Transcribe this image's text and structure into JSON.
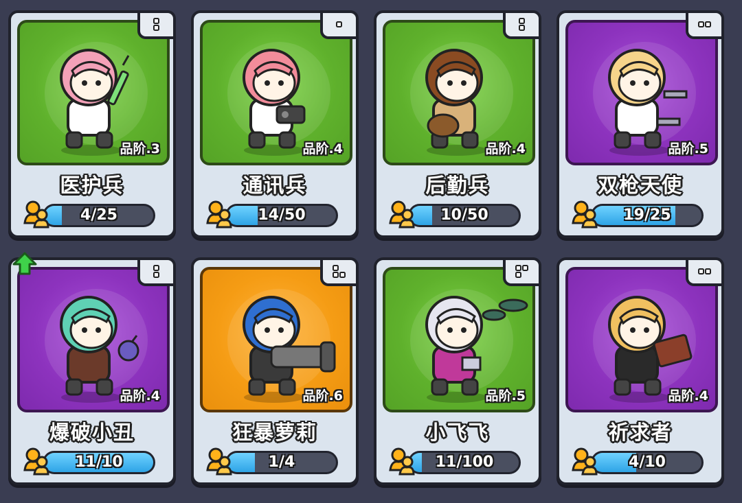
{
  "cards": [
    {
      "name": "医护兵",
      "grade": "品阶.3",
      "progress": "4/25",
      "fill": 0.16,
      "bg": "green",
      "pips": "2v",
      "upgrade": false,
      "hair": "#f3a1b8",
      "outfit": "#ffffff",
      "item": "syringe"
    },
    {
      "name": "通讯兵",
      "grade": "品阶.4",
      "progress": "14/50",
      "fill": 0.28,
      "bg": "green",
      "pips": "1",
      "upgrade": false,
      "hair": "#f28c9a",
      "outfit": "#ffffff",
      "item": "radio"
    },
    {
      "name": "后勤兵",
      "grade": "品阶.4",
      "progress": "10/50",
      "fill": 0.2,
      "bg": "green",
      "pips": "2v",
      "upgrade": false,
      "hair": "#8a4b22",
      "outfit": "#d9b27a",
      "item": "bag"
    },
    {
      "name": "双枪天使",
      "grade": "品阶.5",
      "progress": "19/25",
      "fill": 0.76,
      "bg": "purple",
      "pips": "2h",
      "upgrade": false,
      "hair": "#f6d48a",
      "outfit": "#ffffff",
      "item": "pistols"
    },
    {
      "name": "爆破小丑",
      "grade": "品阶.4",
      "progress": "11/10",
      "fill": 1.0,
      "bg": "purple",
      "pips": "2v",
      "upgrade": true,
      "hair": "#5fd1b4",
      "outfit": "#6b3a2a",
      "item": "bomb"
    },
    {
      "name": "狂暴萝莉",
      "grade": "品阶.6",
      "progress": "1/4",
      "fill": 0.25,
      "bg": "orange",
      "pips": "3",
      "upgrade": false,
      "hair": "#2f6fd0",
      "outfit": "#3a3a3a",
      "item": "gatling"
    },
    {
      "name": "小飞飞",
      "grade": "品阶.5",
      "progress": "11/100",
      "fill": 0.11,
      "bg": "green",
      "pips": "3b",
      "upgrade": false,
      "hair": "#e6e6f0",
      "outfit": "#c0399a",
      "item": "drone"
    },
    {
      "name": "祈求者",
      "grade": "品阶.4",
      "progress": "4/10",
      "fill": 0.4,
      "bg": "purple",
      "pips": "2h",
      "upgrade": false,
      "hair": "#f0c060",
      "outfit": "#2a2a2a",
      "item": "book"
    }
  ],
  "icons": {
    "shard": "shard-icon",
    "upgrade": "upgrade-arrow-icon",
    "rank": "rank-pip-icon"
  }
}
